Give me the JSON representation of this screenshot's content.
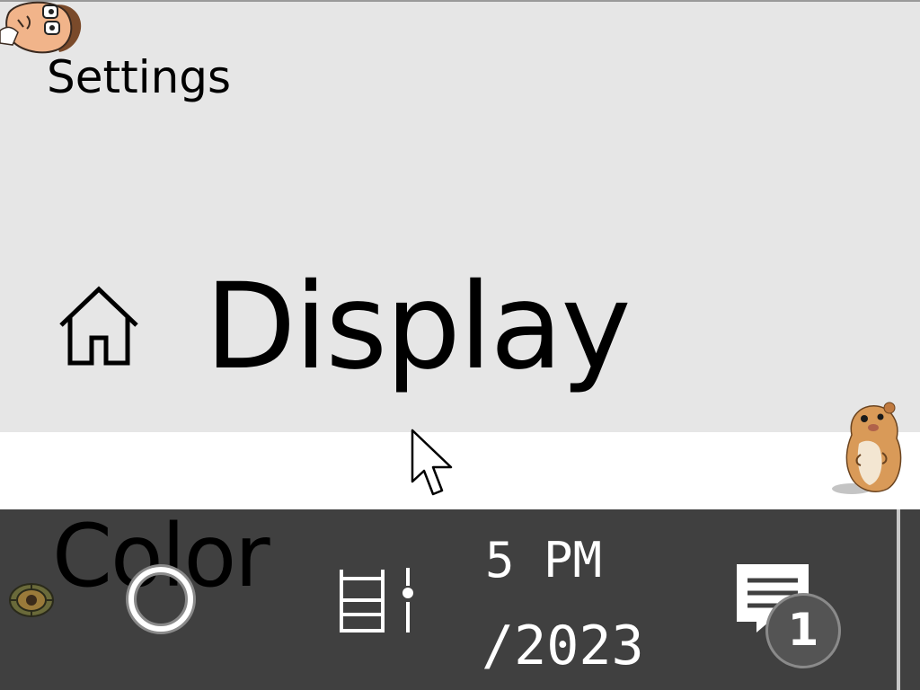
{
  "window": {
    "title": "Settings"
  },
  "page": {
    "heading": "Display",
    "section_heading": "Color",
    "home_icon": "home-icon"
  },
  "taskbar": {
    "search_icon": "search-circle-icon",
    "task_view_icon": "task-view-icon",
    "clock": {
      "time": "5 PM",
      "date": "/2023"
    },
    "notifications": {
      "icon": "action-center-icon",
      "count": "1"
    },
    "pinned_app_icon": "gear-app-icon"
  },
  "overlays": {
    "avatar_icon": "cartoon-man-avatar-icon",
    "pet_icon": "hamster-desktop-pet-icon",
    "cursor_icon": "mouse-pointer-icon"
  },
  "colors": {
    "background": "#e6e6e6",
    "band": "#ffffff",
    "taskbar": "#404040",
    "text_dark": "#000000",
    "text_light": "#ffffff"
  }
}
